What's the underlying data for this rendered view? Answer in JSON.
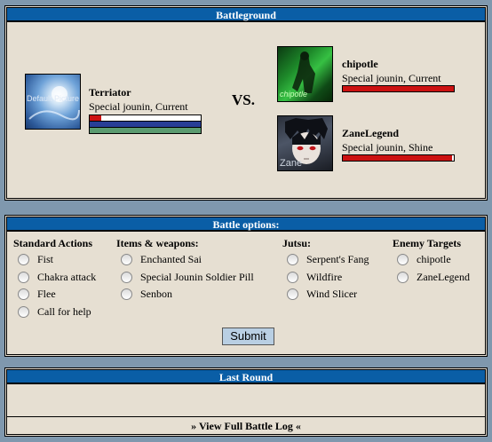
{
  "battleground": {
    "title": "Battleground",
    "vs_label": "VS.",
    "player": {
      "name": "Terriator",
      "rank": "Special jounin, Current",
      "avatar_text": "Default Picture",
      "health": 0.1,
      "chakra": 1.0,
      "stamina": 1.0,
      "bar_colors": {
        "health": "#cc1111",
        "chakra": "#283e96",
        "stamina": "#5b9b70"
      }
    },
    "opponents": [
      {
        "name": "chipotle",
        "rank": "Special jounin, Current",
        "avatar_text": "chipotle",
        "health": 1.0,
        "bar_color": "#cc1111"
      },
      {
        "name": "ZaneLegend",
        "rank": "Special jounin, Shine",
        "avatar_text": "Zane",
        "health": 0.98,
        "bar_color": "#cc1111"
      }
    ]
  },
  "options": {
    "title": "Battle options:",
    "columns": [
      {
        "title": "Standard Actions",
        "items": [
          "Fist",
          "Chakra attack",
          "Flee",
          "Call for help"
        ]
      },
      {
        "title": "Items & weapons:",
        "items": [
          "Enchanted Sai",
          "Special Jounin Soldier Pill",
          "Senbon"
        ]
      },
      {
        "title": "Jutsu:",
        "items": [
          "Serpent's Fang",
          "Wildfire",
          "Wind Slicer"
        ]
      },
      {
        "title": "Enemy Targets",
        "items": [
          "chipotle",
          "ZaneLegend"
        ]
      }
    ],
    "submit_label": "Submit"
  },
  "last_round": {
    "title": "Last Round",
    "log_link": "» View Full Battle Log «"
  }
}
